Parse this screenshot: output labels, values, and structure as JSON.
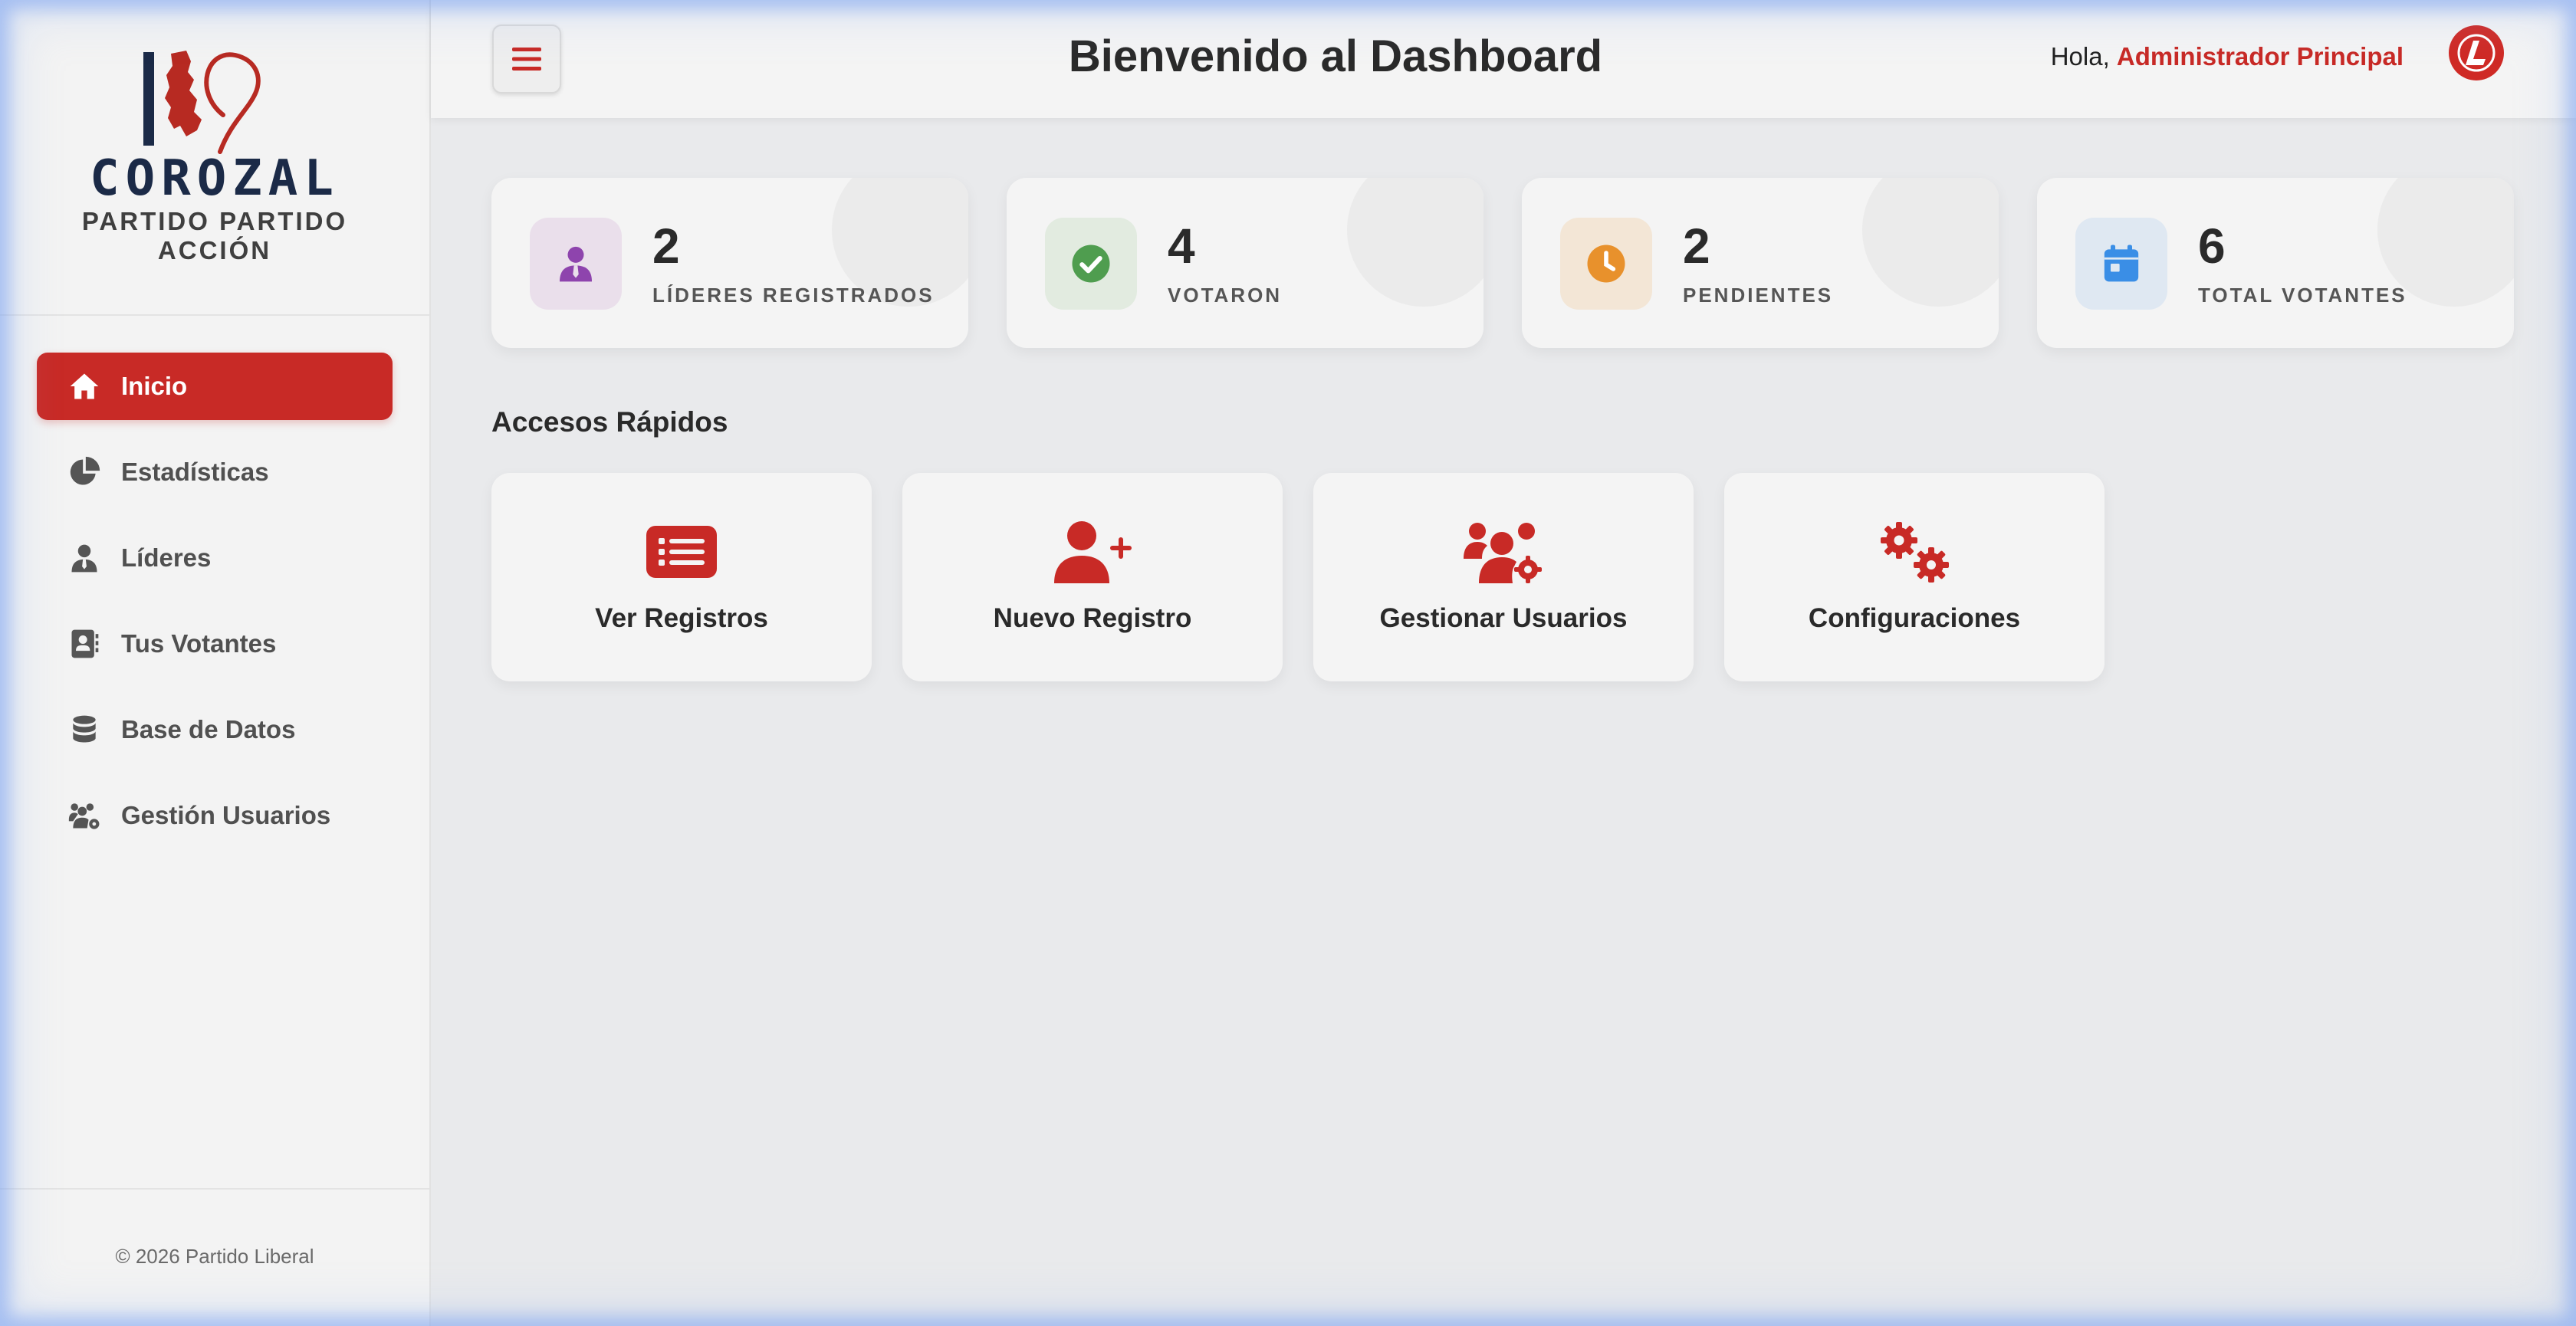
{
  "app": {
    "brand_name": "COROZAL",
    "brand_sub_line1": "PARTIDO PARTIDO",
    "brand_sub_line2": "ACCIÓN",
    "footer": "© 2026 Partido Liberal"
  },
  "sidebar": {
    "items": [
      {
        "label": "Inicio",
        "icon": "home-icon",
        "active": true
      },
      {
        "label": "Estadísticas",
        "icon": "pie-chart-icon",
        "active": false
      },
      {
        "label": "Líderes",
        "icon": "user-tie-icon",
        "active": false
      },
      {
        "label": "Tus Votantes",
        "icon": "address-book-icon",
        "active": false
      },
      {
        "label": "Base de Datos",
        "icon": "database-icon",
        "active": false
      },
      {
        "label": "Gestión Usuarios",
        "icon": "users-gear-icon",
        "active": false
      }
    ]
  },
  "header": {
    "title": "Bienvenido al Dashboard",
    "greeting": "Hola,",
    "user_name": "Administrador Principal",
    "menu_icon": "hamburger-icon",
    "avatar_icon": "liberal-logo-icon"
  },
  "stats": [
    {
      "value": "2",
      "label": "LÍDERES REGISTRADOS",
      "icon": "user-tie-icon",
      "color": "#8e44ad",
      "bg": "#eadfeb"
    },
    {
      "value": "4",
      "label": "VOTARON",
      "icon": "check-circle-icon",
      "color": "#4f9d4f",
      "bg": "#e2ebe0"
    },
    {
      "value": "2",
      "label": "PENDIENTES",
      "icon": "clock-icon",
      "color": "#e8912c",
      "bg": "#f3e6d6"
    },
    {
      "value": "6",
      "label": "TOTAL VOTANTES",
      "icon": "calendar-icon",
      "color": "#3a8ee6",
      "bg": "#dfe8f2"
    }
  ],
  "quick_access": {
    "title": "Accesos Rápidos",
    "items": [
      {
        "label": "Ver Registros",
        "icon": "list-icon"
      },
      {
        "label": "Nuevo Registro",
        "icon": "user-plus-icon"
      },
      {
        "label": "Gestionar Usuarios",
        "icon": "users-gear-icon"
      },
      {
        "label": "Configuraciones",
        "icon": "gears-icon"
      }
    ]
  },
  "colors": {
    "accent": "#c82a26",
    "brand_navy": "#1b2a47"
  }
}
